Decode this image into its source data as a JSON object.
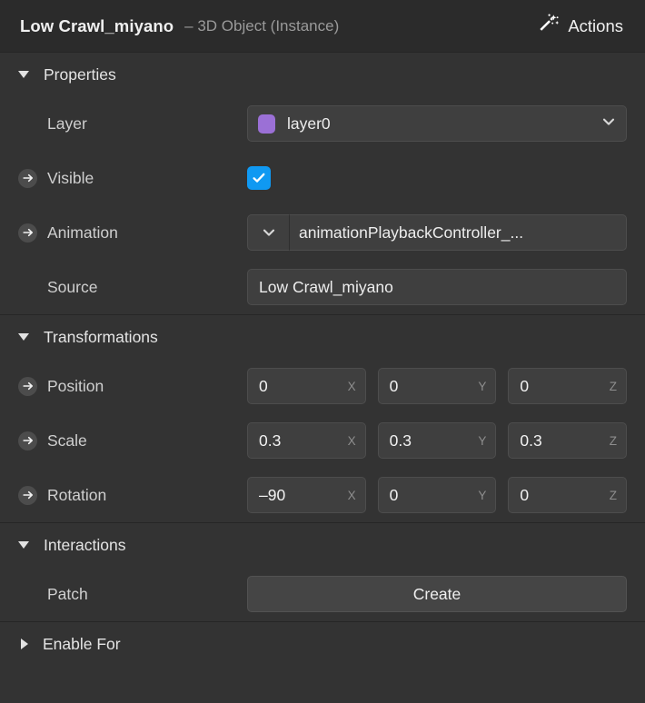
{
  "header": {
    "title": "Low Crawl_miyano",
    "subtitle": "– 3D Object (Instance)",
    "actions_label": "Actions",
    "wand_icon": "magic-wand-icon"
  },
  "sections": {
    "properties": {
      "title": "Properties",
      "expanded": true,
      "rows": {
        "layer": {
          "label": "Layer",
          "value": "layer0",
          "swatch_color": "#9b70d6",
          "chevron_icon": "chevron-down-icon"
        },
        "visible": {
          "label": "Visible",
          "checked": true,
          "checkbox_color": "#1099f2",
          "check_icon": "check-icon",
          "patch_icon": "arrow-circle-icon"
        },
        "animation": {
          "label": "Animation",
          "value": "animationPlaybackController_...",
          "chevron_icon": "chevron-down-icon",
          "patch_icon": "arrow-circle-icon"
        },
        "source": {
          "label": "Source",
          "value": "Low Crawl_miyano"
        }
      }
    },
    "transformations": {
      "title": "Transformations",
      "expanded": true,
      "axis_labels": [
        "X",
        "Y",
        "Z"
      ],
      "rows": {
        "position": {
          "label": "Position",
          "values": [
            "0",
            "0",
            "0"
          ],
          "patch_icon": "arrow-circle-icon"
        },
        "scale": {
          "label": "Scale",
          "values": [
            "0.3",
            "0.3",
            "0.3"
          ],
          "patch_icon": "arrow-circle-icon"
        },
        "rotation": {
          "label": "Rotation",
          "values": [
            "–90",
            "0",
            "0"
          ],
          "patch_icon": "arrow-circle-icon"
        }
      }
    },
    "interactions": {
      "title": "Interactions",
      "expanded": true,
      "rows": {
        "patch": {
          "label": "Patch",
          "button_label": "Create"
        }
      }
    },
    "enable_for": {
      "title": "Enable For",
      "expanded": false
    }
  },
  "theme": {
    "panel_bg": "#333333",
    "header_bg": "#2b2b2b",
    "field_bg": "#3f3f3f",
    "accent_blue": "#1099f2",
    "layer_purple": "#9b70d6",
    "divider": "#262626",
    "label_color": "#cfcfcf"
  }
}
